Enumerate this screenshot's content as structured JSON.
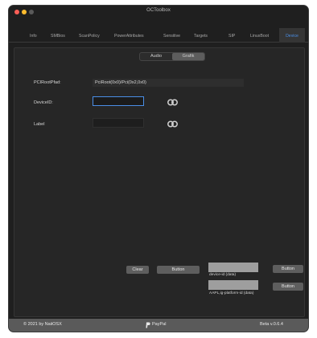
{
  "window": {
    "title": "OCToolbox"
  },
  "tabs": [
    {
      "label": "Info"
    },
    {
      "label": "SMBios"
    },
    {
      "label": "ScanPolicy"
    },
    {
      "label": "PowerAttributes"
    },
    {
      "label": "Sensitive"
    },
    {
      "label": "Targets"
    },
    {
      "label": "SIP"
    },
    {
      "label": "LinuxBoot"
    },
    {
      "label": "Device"
    }
  ],
  "active_tab": "Device",
  "segment": {
    "items": [
      "Audio",
      "Grafik"
    ],
    "selected": "Grafik"
  },
  "form": {
    "pciroot_label": "PCIRootPfad:",
    "pciroot_value": "PciRoot(0x0)/Pci(0x2,0x0)",
    "deviceid_label": "DeviceID:",
    "label_label": "Label"
  },
  "buttons": {
    "clear": "Clear",
    "button1": "Button",
    "button2": "Button",
    "button3": "Button"
  },
  "captions": {
    "device_id": "device-id (data)",
    "aapl_ig": "AAPL,ig-platform-id (data)"
  },
  "statusbar": {
    "copyright": "© 2021 by NaiiOSX",
    "paypal": "PayPal",
    "version": "Beta v.0.6.4"
  },
  "colors": {
    "accent": "#4a8ee6",
    "window_bg": "#1f1f1f",
    "statusbar_bg": "#5a5a5a"
  }
}
